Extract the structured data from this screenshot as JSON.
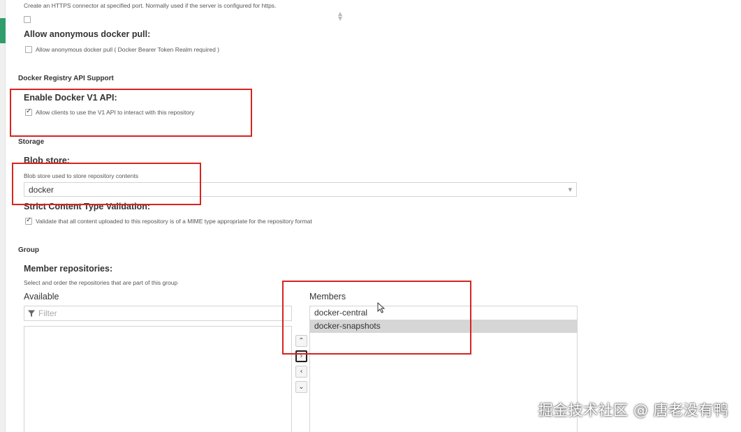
{
  "https": {
    "help": "Create an HTTPS connector at specified port. Normally used if the server is configured for https."
  },
  "anonymous_pull": {
    "label": "Allow anonymous docker pull:",
    "checkbox_text": "Allow anonymous docker pull ( Docker Bearer Token Realm required )",
    "checked": false
  },
  "registry_api": {
    "section_title": "Docker Registry API Support",
    "v1_label": "Enable Docker V1 API:",
    "v1_checkbox_text": "Allow clients to use the V1 API to interact with this repository",
    "v1_checked": true
  },
  "storage": {
    "section_title": "Storage",
    "blob_label": "Blob store:",
    "blob_help": "Blob store used to store repository contents",
    "blob_value": "docker",
    "strict_label": "Strict Content Type Validation:",
    "strict_checkbox_text": "Validate that all content uploaded to this repository is of a MIME type appropriate for the repository format",
    "strict_checked": true
  },
  "group": {
    "section_title": "Group",
    "members_label": "Member repositories:",
    "members_help": "Select and order the repositories that are part of this group",
    "available_label": "Available",
    "filter_placeholder": "Filter",
    "members_col_label": "Members",
    "members": [
      "docker-central",
      "docker-snapshots"
    ],
    "selected_member": "docker-snapshots"
  },
  "watermark": "掘金技术社区 @ 唐老没有鸭",
  "colors": {
    "annotation_red": "#d8231f",
    "accent_green": "#2f9e6a",
    "selected_row": "#d6d6d6"
  },
  "icons": {
    "move_up": "chevron-up-icon",
    "move_right": "chevron-right-icon",
    "move_left": "chevron-left-icon",
    "move_down": "chevron-down-icon",
    "filter": "filter-icon"
  }
}
